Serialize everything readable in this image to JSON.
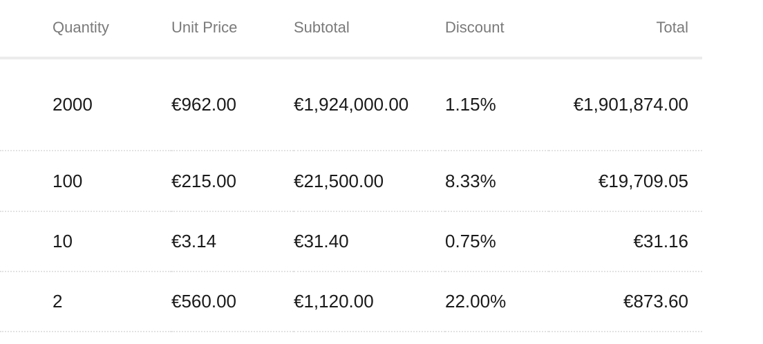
{
  "table": {
    "headers": {
      "quantity": "Quantity",
      "unit_price": "Unit Price",
      "subtotal": "Subtotal",
      "discount": "Discount",
      "total": "Total"
    },
    "rows": [
      {
        "quantity": "2000",
        "unit_price": "€962.00",
        "subtotal": "€1,924,000.00",
        "discount": "1.15%",
        "total": "€1,901,874.00"
      },
      {
        "quantity": "100",
        "unit_price": "€215.00",
        "subtotal": "€21,500.00",
        "discount": "8.33%",
        "total": "€19,709.05"
      },
      {
        "quantity": "10",
        "unit_price": "€3.14",
        "subtotal": "€31.40",
        "discount": "0.75%",
        "total": "€31.16"
      },
      {
        "quantity": "2",
        "unit_price": "€560.00",
        "subtotal": "€1,120.00",
        "discount": "22.00%",
        "total": "€873.60"
      }
    ]
  }
}
